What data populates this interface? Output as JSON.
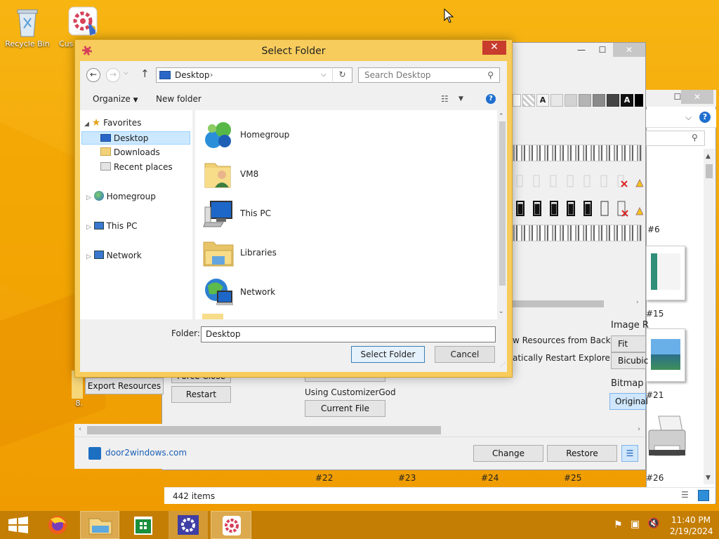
{
  "desktop": {
    "icons": [
      {
        "label": "Recycle Bin"
      },
      {
        "label": "Cus"
      },
      {
        "label": "8."
      }
    ]
  },
  "back_window": {
    "buttons": {
      "export_resources": "Export Resources",
      "force_close": "Force Close",
      "restart": "Restart",
      "using": "Using CustomizerGod",
      "current_file": "Current File",
      "change": "Change",
      "restore": "Restore"
    },
    "options": {
      "from_backup": "w Resources from Backup",
      "auto_restart": "atically Restart Explorer"
    },
    "link": "door2windows.com"
  },
  "third_window": {
    "image_header": "Image R",
    "fit_button": "Fit Resiz",
    "bicubic_button": "Bicubic",
    "bitmap_label": "Bitmap",
    "original_button": "Original",
    "thumb_labels": [
      "#6",
      "#15",
      "#21",
      "#22",
      "#23",
      "#24",
      "#25",
      "#26"
    ],
    "status": "442 items"
  },
  "dialog": {
    "title": "Select Folder",
    "address": "Desktop",
    "search_placeholder": "Search Desktop",
    "organize": "Organize",
    "new_folder": "New folder",
    "tree": {
      "favorites": "Favorites",
      "desktop": "Desktop",
      "downloads": "Downloads",
      "recent": "Recent places",
      "homegroup": "Homegroup",
      "thispc": "This PC",
      "network": "Network"
    },
    "items": [
      "Homegroup",
      "VM8",
      "This PC",
      "Libraries",
      "Network"
    ],
    "folder_label": "Folder:",
    "folder_value": "Desktop",
    "select_button": "Select Folder",
    "cancel_button": "Cancel"
  },
  "taskbar": {
    "time": "11:40 PM",
    "date": "2/19/2024"
  },
  "colors": {
    "desktop_bg": "#f4aa0a",
    "dialog_frame": "#f7cc5c",
    "close_red": "#c73c2d",
    "taskbar": "#c47e04",
    "selection": "#cce8ff",
    "link": "#1a5fb4"
  }
}
